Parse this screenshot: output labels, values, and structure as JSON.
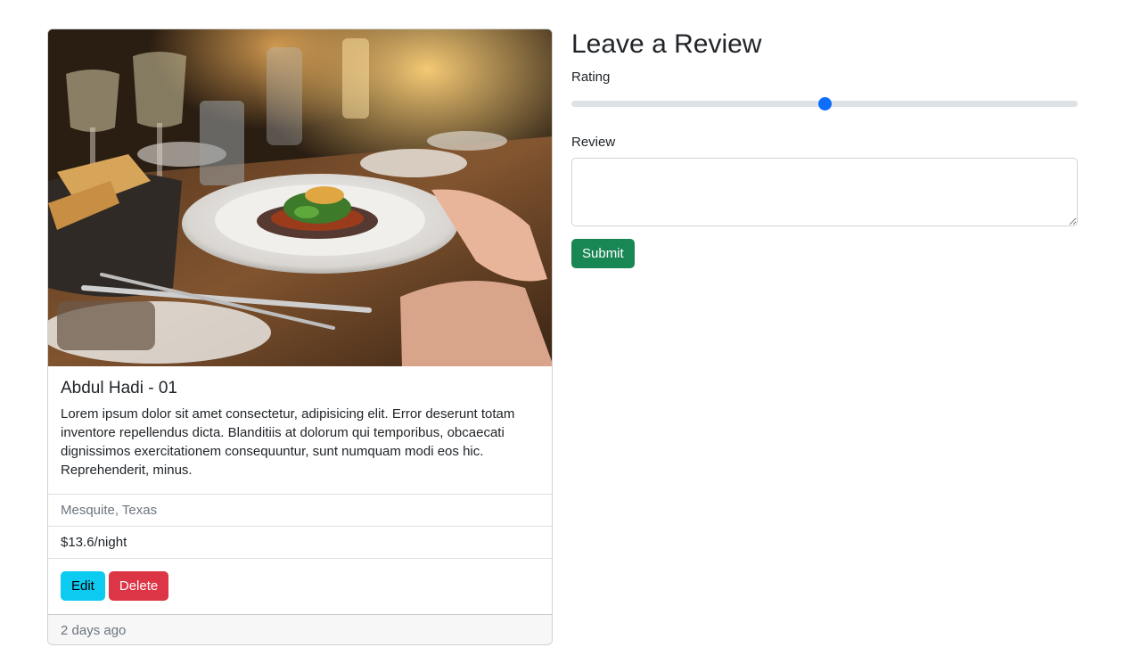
{
  "listing": {
    "title": "Abdul Hadi - 01",
    "description": "Lorem ipsum dolor sit amet consectetur, adipisicing elit. Error deserunt totam inventore repellendus dicta. Blanditiis at dolorum qui temporibus, obcaecati dignissimos exercitationem consequuntur, sunt numquam modi eos hic. Reprehenderit, minus.",
    "location": "Mesquite, Texas",
    "price": "$13.6/night",
    "edit_label": "Edit",
    "delete_label": "Delete",
    "footer": "2 days ago"
  },
  "review_form": {
    "heading": "Leave a Review",
    "rating_label": "Rating",
    "rating_min": 1,
    "rating_max": 5,
    "rating_value": 3,
    "review_label": "Review",
    "review_value": "",
    "submit_label": "Submit"
  },
  "colors": {
    "info": "#0dcaf0",
    "danger": "#dc3545",
    "success": "#198754",
    "primary": "#0d6efd"
  },
  "icons": {
    "textarea_resize": "resize-grip-icon"
  }
}
